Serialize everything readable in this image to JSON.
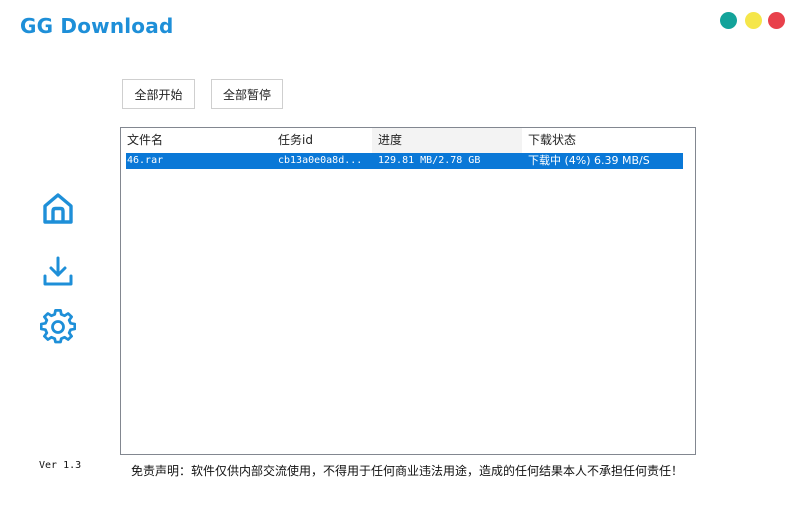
{
  "app": {
    "title": "GG Download",
    "version": "Ver 1.3"
  },
  "window_controls": [
    {
      "name": "teal-window-button",
      "color": "#13a39a"
    },
    {
      "name": "yellow-window-button",
      "color": "#f5e64a"
    },
    {
      "name": "red-window-button",
      "color": "#e8414b"
    }
  ],
  "sidebar": {
    "icons": [
      "home-icon",
      "download-icon",
      "settings-icon"
    ],
    "accent_color": "#1e8fd8"
  },
  "toolbar": {
    "start_all_label": "全部开始",
    "pause_all_label": "全部暂停"
  },
  "table": {
    "columns": [
      "文件名",
      "任务id",
      "进度",
      "下载状态"
    ],
    "rows": [
      {
        "file_name": "46.rar",
        "task_id": "cb13a0e0a8d...",
        "progress": "129.81 MB/2.78 GB",
        "status": "下载中 (4%) 6.39 MB/S",
        "selected": true
      }
    ]
  },
  "footer": {
    "disclaimer": "免责声明：软件仅供内部交流使用，不得用于任何商业违法用途，造成的任何结果本人不承担任何责任！"
  }
}
